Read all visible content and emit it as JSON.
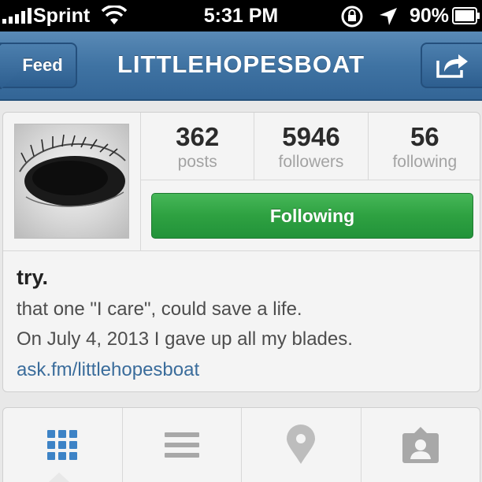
{
  "status_bar": {
    "carrier": "Sprint",
    "time": "5:31 PM",
    "battery_percent": "90%",
    "signal_bars": 5
  },
  "nav": {
    "back_label": "Feed",
    "title": "LITTLEHOPESBOAT",
    "share_icon": "share-icon"
  },
  "profile": {
    "stats": [
      {
        "value": "362",
        "label": "posts"
      },
      {
        "value": "5946",
        "label": "followers"
      },
      {
        "value": "56",
        "label": "following"
      }
    ],
    "follow_button": "Following",
    "bio": {
      "name": "try.",
      "lines": [
        "that one \"I care\", could save a life.",
        "On July 4, 2013 I gave up all my blades."
      ],
      "link": "ask.fm/littlehopesboat"
    }
  },
  "tabs": [
    {
      "icon": "grid-icon",
      "active": true
    },
    {
      "icon": "list-icon",
      "active": false
    },
    {
      "icon": "location-pin-icon",
      "active": false
    },
    {
      "icon": "tagged-photos-icon",
      "active": false
    }
  ],
  "colors": {
    "nav_blue": "#3f73a3",
    "follow_green": "#2ea141",
    "link_blue": "#3a6c9b",
    "active_tab_blue": "#3d83c6"
  }
}
